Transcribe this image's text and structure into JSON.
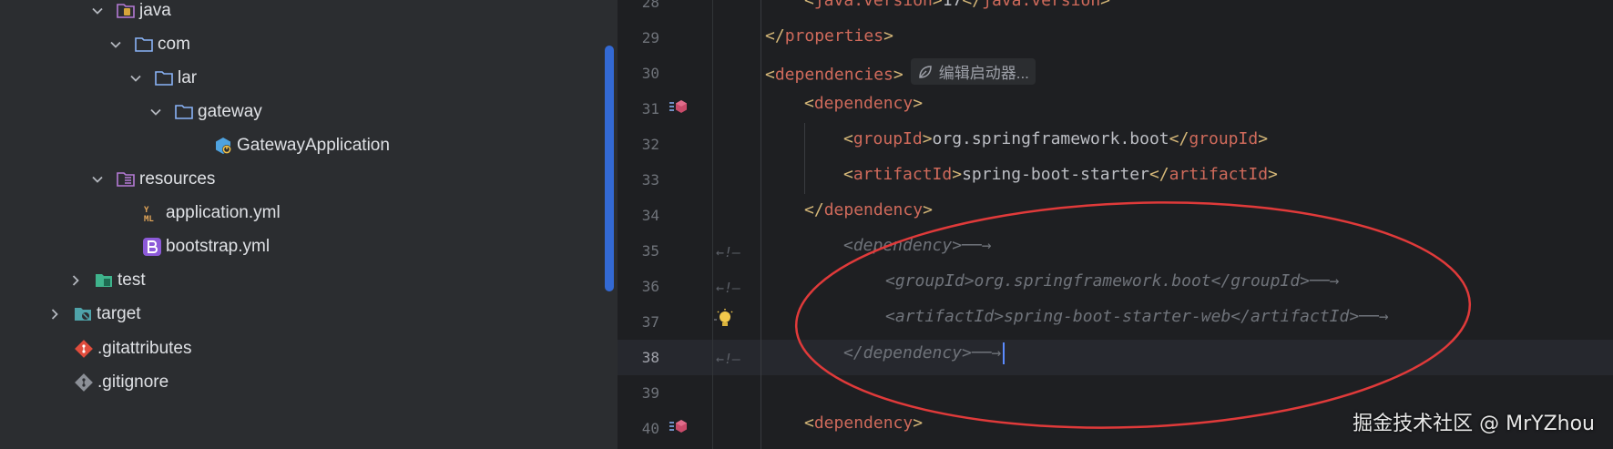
{
  "tree": {
    "items": [
      {
        "label": "java",
        "icon": "source-folder-java-icon"
      },
      {
        "label": "com",
        "icon": "folder-icon"
      },
      {
        "label": "lar",
        "icon": "folder-icon"
      },
      {
        "label": "gateway",
        "icon": "folder-icon"
      },
      {
        "label": "GatewayApplication",
        "icon": "spring-boot-class-icon"
      },
      {
        "label": "resources",
        "icon": "resources-folder-icon"
      },
      {
        "label": "application.yml",
        "icon": "yaml-file-icon"
      },
      {
        "label": "bootstrap.yml",
        "icon": "bootstrap-file-icon"
      },
      {
        "label": "test",
        "icon": "test-folder-icon"
      },
      {
        "label": "target",
        "icon": "excluded-folder-icon"
      },
      {
        "label": ".gitattributes",
        "icon": "git-file-icon"
      },
      {
        "label": ".gitignore",
        "icon": "git-ignore-icon"
      }
    ]
  },
  "editor": {
    "current_line": "38",
    "lines": [
      {
        "n": "28",
        "open": "<",
        "name": "java.version",
        "text": "17",
        "close_name": "java.version"
      },
      {
        "n": "29",
        "closing": "</",
        "name": "properties",
        "end": ">"
      },
      {
        "n": "30",
        "open": "<",
        "name": "dependencies",
        "end": ">",
        "inlay": "编辑启动器..."
      },
      {
        "n": "31",
        "open": "<",
        "name": "dependency",
        "end": ">"
      },
      {
        "n": "32",
        "open": "<",
        "name": "groupId",
        "text": "org.springframework.boot",
        "close_name": "groupId"
      },
      {
        "n": "33",
        "open": "<",
        "name": "artifactId",
        "text": "spring-boot-starter",
        "close_name": "artifactId"
      },
      {
        "n": "34",
        "closing": "</",
        "name": "dependency",
        "end": ">"
      },
      {
        "n": "35",
        "comment": "<dependency>──→"
      },
      {
        "n": "36",
        "comment": "<groupId>org.springframework.boot</groupId>──→"
      },
      {
        "n": "37",
        "comment": "<artifactId>spring-boot-starter-web</artifactId>──→"
      },
      {
        "n": "38",
        "comment": "</dependency>──→"
      },
      {
        "n": "39"
      },
      {
        "n": "40",
        "open": "<",
        "name": "dependency",
        "end": ">"
      }
    ],
    "fold_marker": "←!—"
  },
  "watermark": "掘金技术社区 @ MrYZhou",
  "colors": {
    "annotation": "#e03a3a",
    "tag_name": "#cf6a5b",
    "comment": "#6f737a",
    "scrollbar": "#3574f0"
  }
}
